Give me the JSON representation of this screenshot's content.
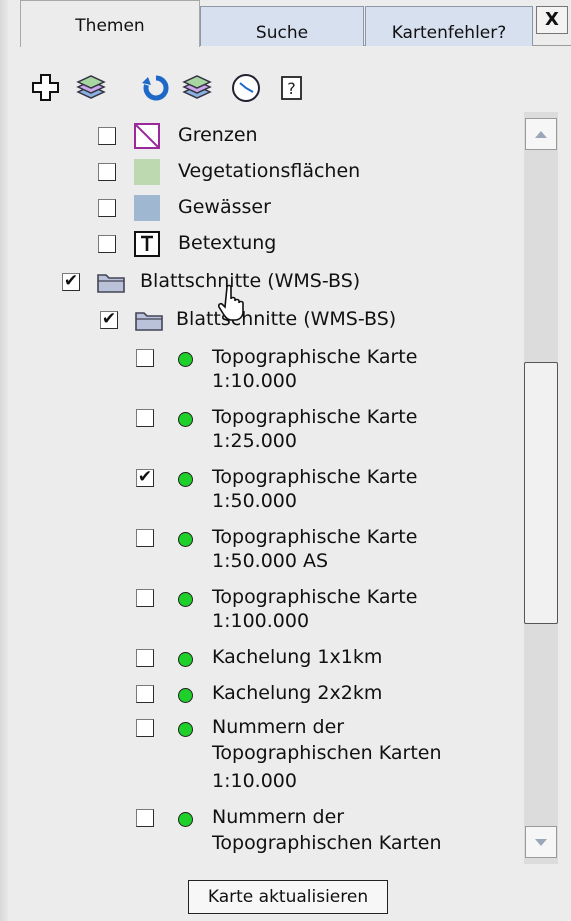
{
  "tabs": [
    {
      "label": "Themen",
      "active": true
    },
    {
      "label": "Suche",
      "active": false
    },
    {
      "label": "Kartenfehler?",
      "active": false
    }
  ],
  "close_label": "X",
  "toolbar": [
    "add-layer-icon",
    "layers-icon",
    "refresh-icon",
    "layers-icon",
    "clock-icon",
    "help-icon"
  ],
  "tree": {
    "grenzen": "Grenzen",
    "vegetation": "Vegetationsflächen",
    "gewaesser": "Gewässer",
    "betextung": "Betextung",
    "blattschnitte_group": "Blattschnitte (WMS-BS)",
    "blattschnitte_sub": "Blattschnitte (WMS-BS)",
    "tk10_1": "Topographische Karte",
    "tk10_2": "1:10.000",
    "tk25_1": "Topographische Karte",
    "tk25_2": "1:25.000",
    "tk50_1": "Topographische Karte",
    "tk50_2": "1:50.000",
    "tk50as_1": "Topographische Karte",
    "tk50as_2": "1:50.000 AS",
    "tk100_1": "Topographische Karte",
    "tk100_2": "1:100.000",
    "kachel1": "Kachelung 1x1km",
    "kachel2": "Kachelung 2x2km",
    "nr10_1": "Nummern der",
    "nr10_2": "Topographischen Karten",
    "nr10_3": "1:10.000",
    "nr_next_1": "Nummern der",
    "nr_next_2": "Topographischen Karten"
  },
  "checks": {
    "blattschnitte_group": true,
    "blattschnitte_sub": true,
    "tk50": true
  },
  "colors": {
    "vegetation": "#bcd9b0",
    "gewaesser": "#9fb7d0",
    "status_dot": "#1fcf2a"
  },
  "update_button": "Karte aktualisieren"
}
